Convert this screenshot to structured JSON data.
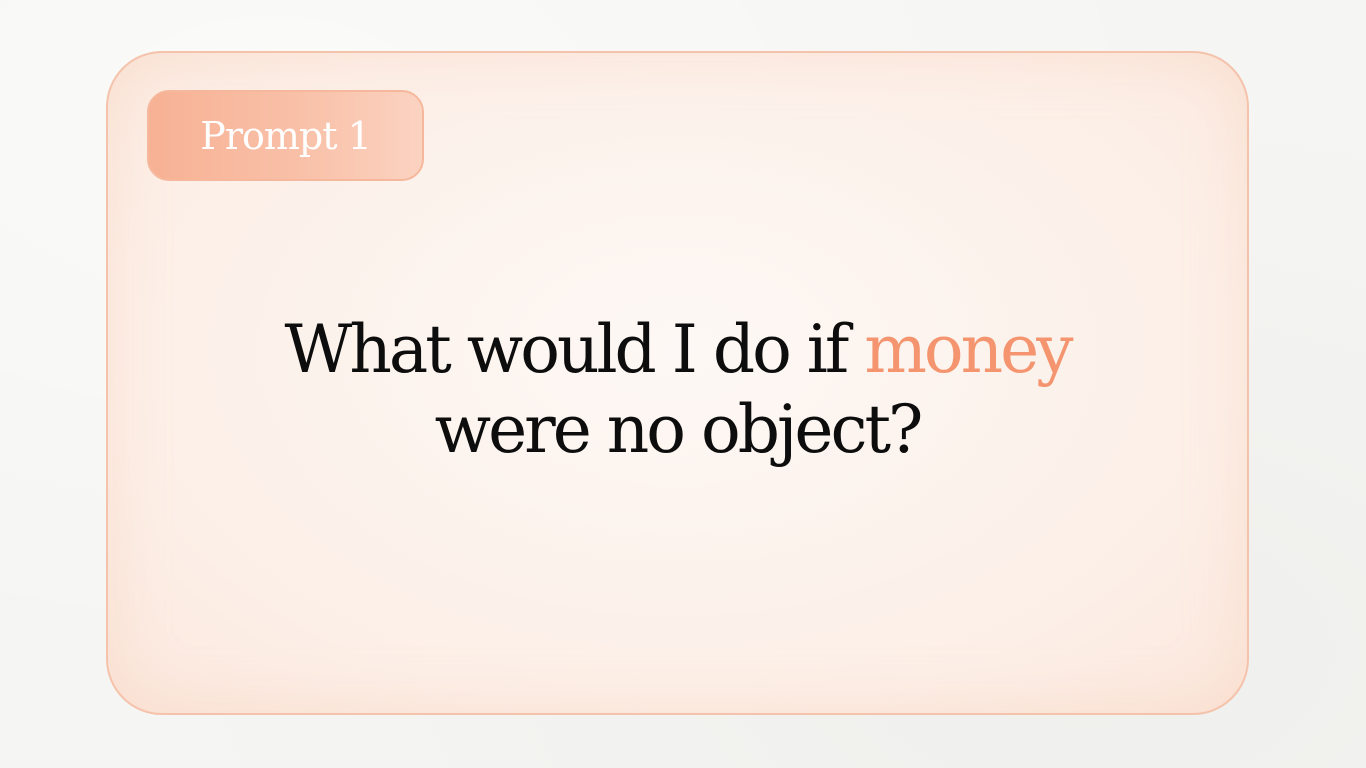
{
  "badge": {
    "label": "Prompt 1"
  },
  "question": {
    "line1_before": "What would I do if ",
    "line1_highlight": "money",
    "line2": "were no object?"
  },
  "colors": {
    "accent": "#f4956f",
    "badge_fill": "#f8b79b",
    "card_border": "#f5c3ac",
    "text": "#0d0d0d"
  }
}
